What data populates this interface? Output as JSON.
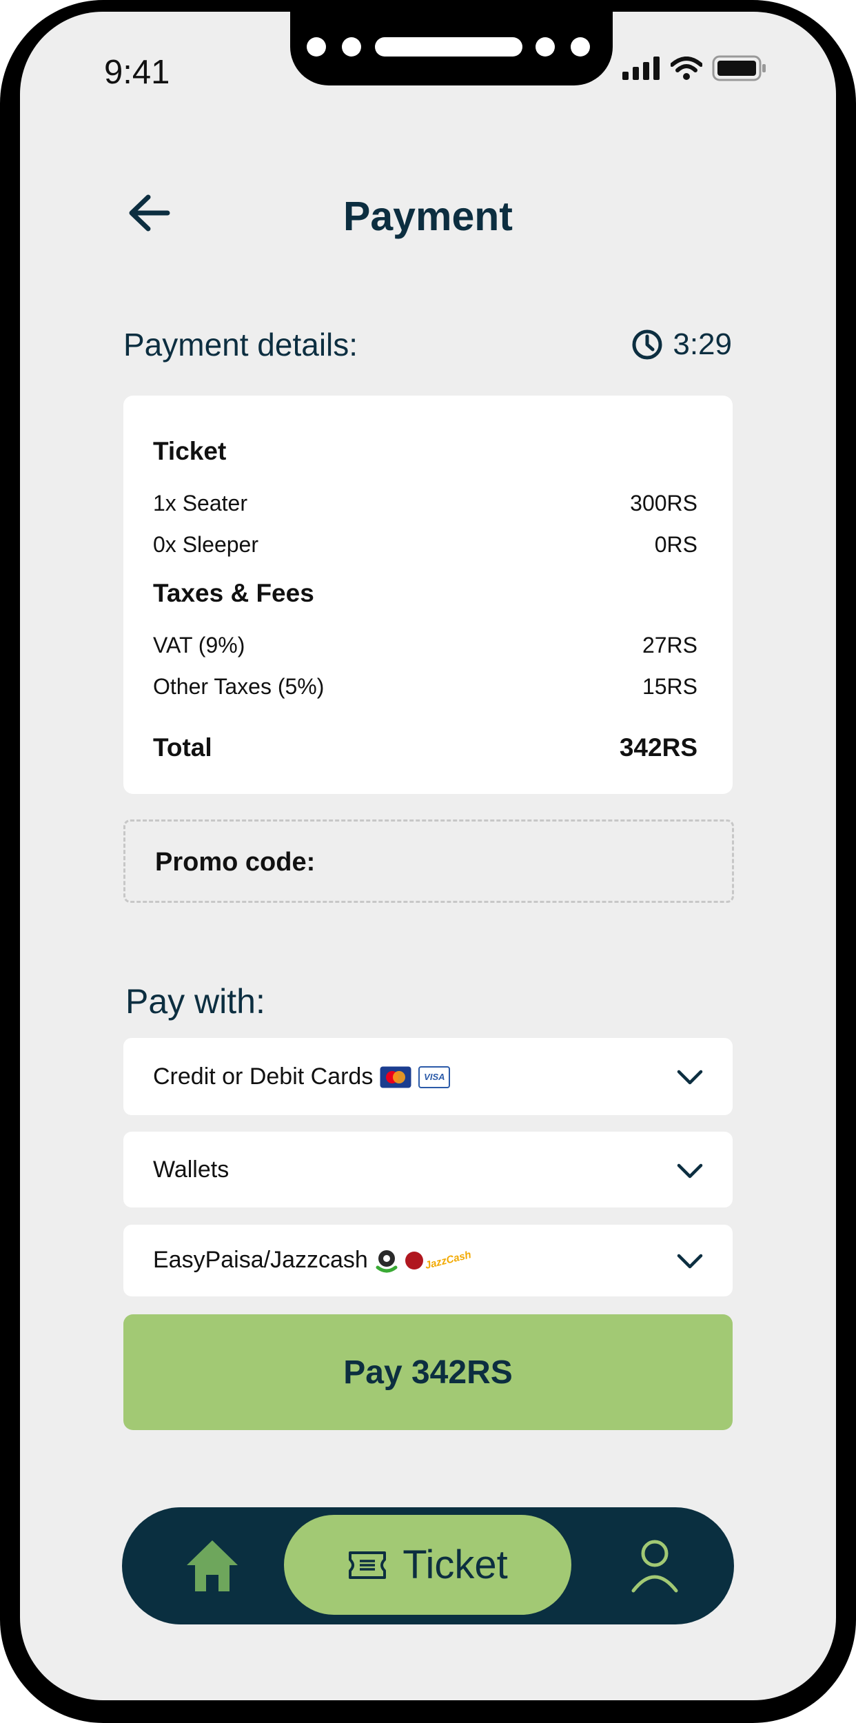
{
  "status_bar": {
    "time": "9:41"
  },
  "header": {
    "title": "Payment"
  },
  "payment_details": {
    "label": "Payment details:",
    "timer": "3:29"
  },
  "summary": {
    "ticket_title": "Ticket",
    "ticket_rows": [
      {
        "label": "1x Seater",
        "value": "300RS"
      },
      {
        "label": "0x Sleeper",
        "value": "0RS"
      }
    ],
    "taxes_title": "Taxes & Fees",
    "tax_rows": [
      {
        "label": "VAT (9%)",
        "value": "27RS"
      },
      {
        "label": "Other Taxes (5%)",
        "value": "15RS"
      }
    ],
    "total_label": "Total",
    "total_value": "342RS"
  },
  "promo": {
    "label": "Promo code:"
  },
  "pay_with": {
    "label": "Pay with:",
    "methods": [
      {
        "label": "Credit or Debit Cards",
        "icons": [
          "mastercard-icon",
          "visa-icon"
        ],
        "visa_text": "VISA"
      },
      {
        "label": "Wallets"
      },
      {
        "label": "EasyPaisa/Jazzcash",
        "icons": [
          "easypaisa-icon",
          "jazzcash-icon"
        ],
        "jazzcash_text": "JazzCash"
      }
    ]
  },
  "pay_button": {
    "label": "Pay 342RS"
  },
  "bottom_nav": {
    "active_label": "Ticket"
  },
  "colors": {
    "navy": "#0a2f40",
    "accent_green": "#a2c974",
    "background": "#eeeeee",
    "card": "#ffffff"
  }
}
